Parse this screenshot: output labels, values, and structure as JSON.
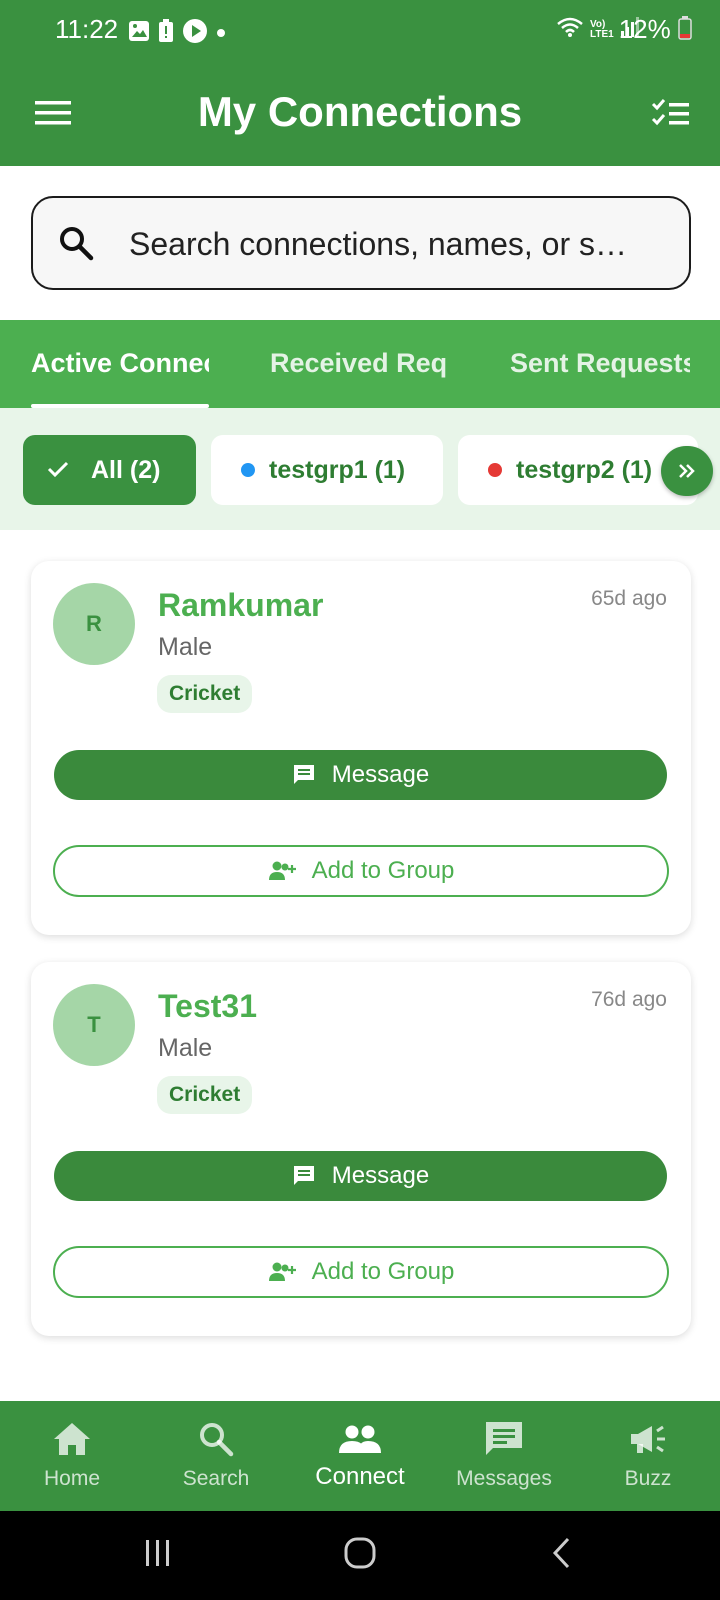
{
  "status_bar": {
    "time": "11:22",
    "battery": "12%",
    "network": "Vo) LTE1",
    "icons_left": [
      "image-icon",
      "alert-icon",
      "play-icon",
      "dot-icon"
    ],
    "icons_right": [
      "wifi-icon",
      "lte-icon",
      "signal-icon",
      "battery-icon"
    ]
  },
  "app_bar": {
    "title": "My Connections",
    "menu_icon": "menu-icon",
    "action_icon": "checklist-icon"
  },
  "search": {
    "placeholder": "Search connections, names, or s…"
  },
  "tabs": [
    {
      "label": "Active Connections",
      "active": true
    },
    {
      "label": "Received Requests",
      "active": false
    },
    {
      "label": "Sent Requests",
      "active": false
    }
  ],
  "groups": {
    "chips": [
      {
        "label": "All (2)",
        "selected": true
      },
      {
        "label": "testgrp1 (1)",
        "color": "#2196f3",
        "selected": false
      },
      {
        "label": "testgrp2 (1)",
        "color": "#e53935",
        "selected": false
      }
    ],
    "more_icon": "double-chevron-right-icon"
  },
  "connections": [
    {
      "initial": "R",
      "name": "Ramkumar",
      "gender": "Male",
      "interest": "Cricket",
      "time_ago": "65d ago",
      "message_label": "Message",
      "add_group_label": "Add to Group"
    },
    {
      "initial": "T",
      "name": "Test31",
      "gender": "Male",
      "interest": "Cricket",
      "time_ago": "76d ago",
      "message_label": "Message",
      "add_group_label": "Add to Group"
    }
  ],
  "bottom_nav": [
    {
      "label": "Home",
      "icon": "home-icon",
      "active": false
    },
    {
      "label": "Search",
      "icon": "search-icon",
      "active": false
    },
    {
      "label": "Connect",
      "icon": "people-icon",
      "active": true
    },
    {
      "label": "Messages",
      "icon": "chat-icon",
      "active": false
    },
    {
      "label": "Buzz",
      "icon": "megaphone-icon",
      "active": false
    }
  ],
  "colors": {
    "primary": "#3a9140",
    "accent": "#4caf50",
    "chip_bg": "#e8f5e9",
    "avatar_bg": "#a5d6a7"
  }
}
